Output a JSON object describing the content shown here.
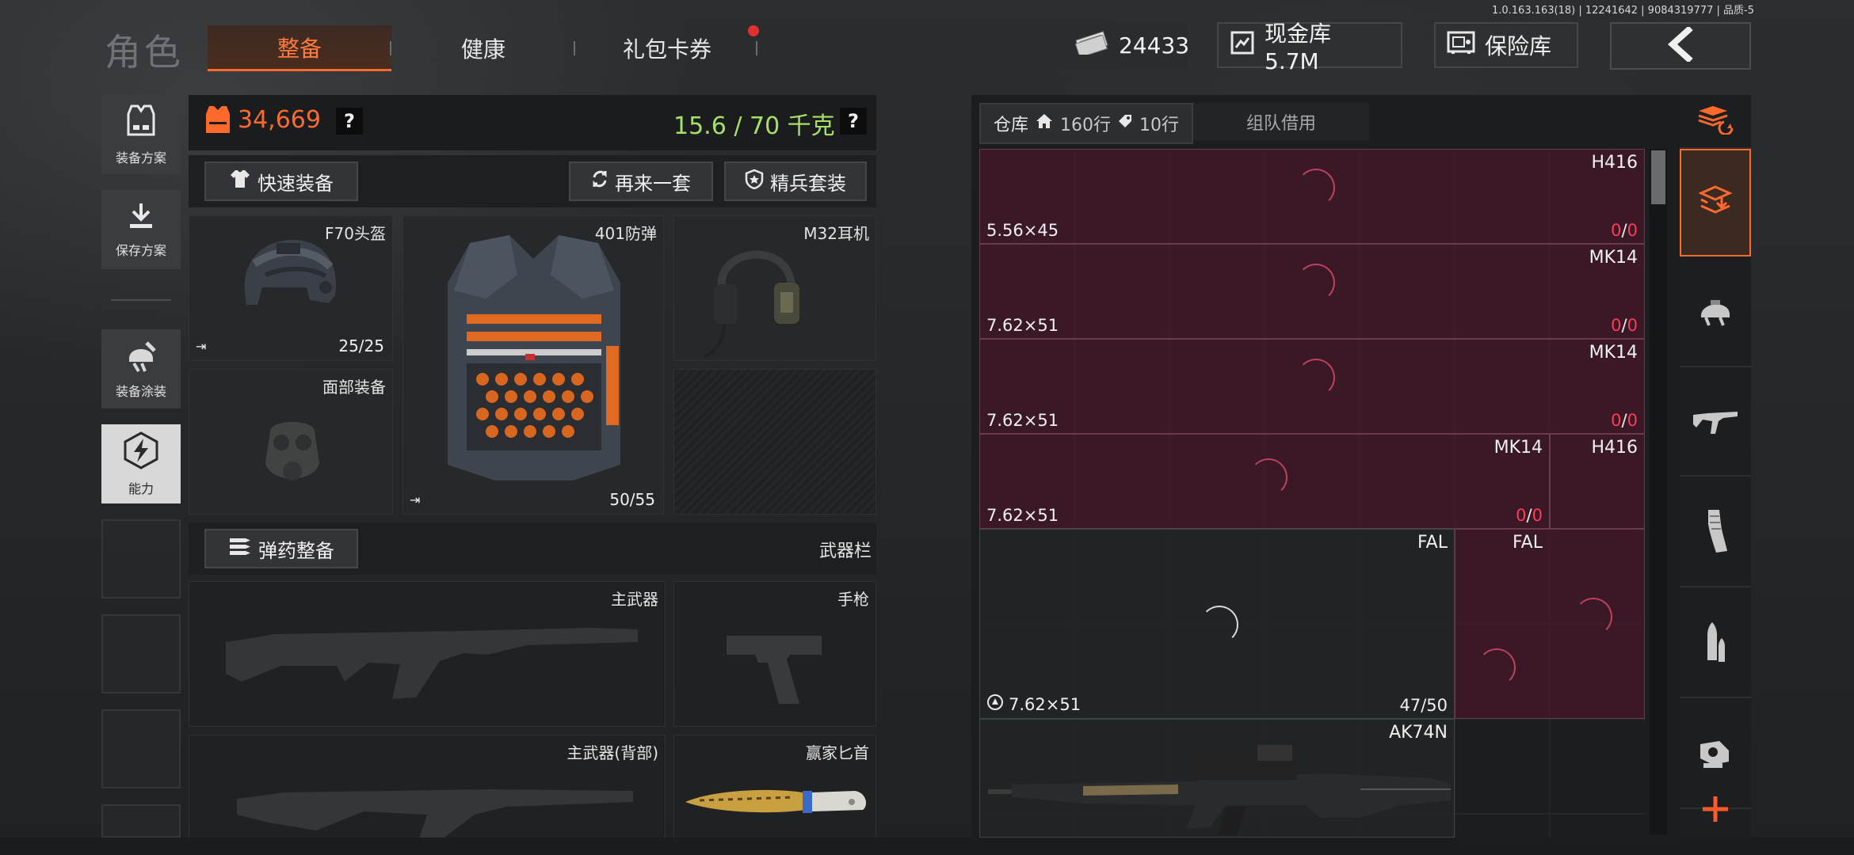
{
  "version_text": "1.0.163.163(18) | 12241642 | 9084319777 | 品质-5",
  "header": {
    "role_title": "角色",
    "tabs": [
      {
        "label": "整备",
        "active": true
      },
      {
        "label": "健康",
        "active": false
      },
      {
        "label": "礼包卡券",
        "active": false,
        "has_dot": true
      }
    ],
    "currency": "24433",
    "cash_vault": "现金库 5.7M",
    "safe_box": "保险库"
  },
  "left_nav": [
    {
      "label": "装备方案",
      "icon": "vest-plan-icon"
    },
    {
      "label": "保存方案",
      "icon": "download-icon"
    },
    {
      "label": "装备涂装",
      "icon": "helmet-skin-icon"
    },
    {
      "label": "能力",
      "icon": "ability-icon",
      "highlight": true
    }
  ],
  "loadout": {
    "value": "34,669",
    "weight": "15.6 / 70 千克",
    "quick_equip": "快速装备",
    "retry": "再来一套",
    "elite_set": "精兵套装",
    "slots": {
      "helmet": {
        "name": "F70头盔",
        "count": "25/25"
      },
      "armor": {
        "name": "401防弹",
        "count": "50/55"
      },
      "headset": {
        "name": "M32耳机"
      },
      "face": {
        "name": "面部装备"
      }
    },
    "ammo_equip": "弹药整备",
    "weapon_bar": "武器栏",
    "weapons": {
      "primary": "主武器",
      "pistol": "手枪",
      "primary_back": "主武器(背部)",
      "knife": "赢家匕首"
    }
  },
  "warehouse": {
    "tab_label": "仓库",
    "rows_home": "160行",
    "rows_tag": "10行",
    "team_borrow": "组队借用",
    "items": [
      {
        "name": "H416",
        "caliber": "5.56×45",
        "count_a": "0",
        "count_b": "0"
      },
      {
        "name": "MK14",
        "caliber": "7.62×51",
        "count_a": "0",
        "count_b": "0"
      },
      {
        "name": "MK14",
        "caliber": "7.62×51",
        "count_a": "0",
        "count_b": "0"
      },
      {
        "name": "MK14",
        "caliber": "7.62×51",
        "count_a": "0",
        "count_b": "0"
      },
      {
        "name": "H416"
      },
      {
        "name": "FAL",
        "caliber": "7.62×51",
        "count": "47/50"
      },
      {
        "name": "FAL"
      },
      {
        "name": "AK74N"
      }
    ]
  },
  "categories": [
    "stack-refresh-icon",
    "stack-download-icon",
    "helmet-icon",
    "rifle-icon",
    "magazine-icon",
    "ammo-icon",
    "scope-icon",
    "plus-icon"
  ],
  "colors": {
    "accent": "#ff6a2c",
    "price": "#ff6a2c",
    "weight": "#a8e063",
    "item_bg": "#46162a",
    "red_count": "#ff3a5a"
  }
}
